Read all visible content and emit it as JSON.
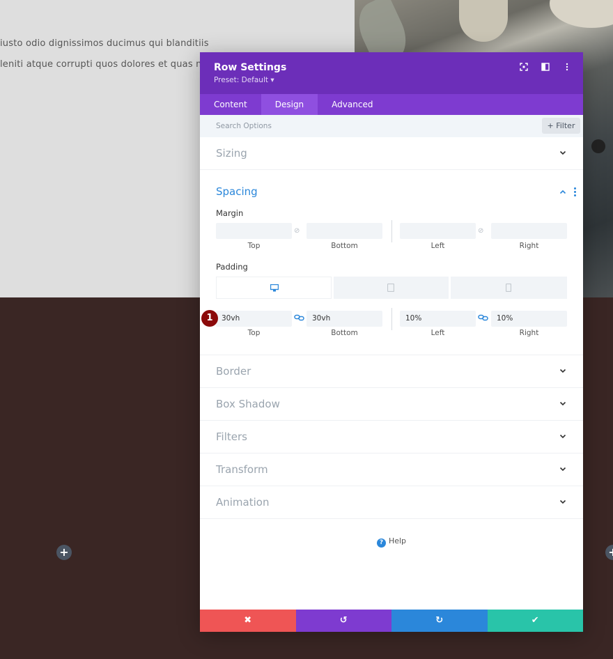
{
  "background": {
    "text_line_1": "iusto odio dignissimos ducimus qui blanditiis",
    "text_line_2": "leniti atque corrupti quos dolores et quas m",
    "add_symbol": "+"
  },
  "modal": {
    "title": "Row Settings",
    "preset": "Preset: Default ▾",
    "header_icons": [
      "expand-icon",
      "sidebar-icon",
      "more-vertical-icon"
    ],
    "tabs": [
      {
        "label": "Content",
        "active": false
      },
      {
        "label": "Design",
        "active": true
      },
      {
        "label": "Advanced",
        "active": false
      }
    ],
    "search": {
      "placeholder": "Search Options",
      "filter_label": "+ Filter"
    },
    "sections_before": [
      {
        "title": "Sizing"
      }
    ],
    "spacing": {
      "title": "Spacing",
      "margin_label": "Margin",
      "margin": {
        "top": "",
        "bottom": "",
        "left": "",
        "right": ""
      },
      "padding_label": "Padding",
      "padding": {
        "top": "30vh",
        "bottom": "30vh",
        "left": "10%",
        "right": "10%"
      },
      "captions": {
        "top": "Top",
        "bottom": "Bottom",
        "left": "Left",
        "right": "Right"
      },
      "devices": [
        "desktop-icon",
        "tablet-icon",
        "phone-icon"
      ]
    },
    "sections_after": [
      {
        "title": "Border"
      },
      {
        "title": "Box Shadow"
      },
      {
        "title": "Filters"
      },
      {
        "title": "Transform"
      },
      {
        "title": "Animation"
      }
    ],
    "help_label": "Help",
    "step_badge": "1",
    "footer": {
      "discard": "✖",
      "undo": "↺",
      "redo": "↻",
      "save": "✔"
    },
    "colors": {
      "header": "#6c2eb9",
      "tabs": "#7e3bd0",
      "discard": "#ef5555",
      "undo": "#7e3bd0",
      "redo": "#2b87da",
      "save": "#29c4a9",
      "accent": "#2b87da"
    }
  }
}
